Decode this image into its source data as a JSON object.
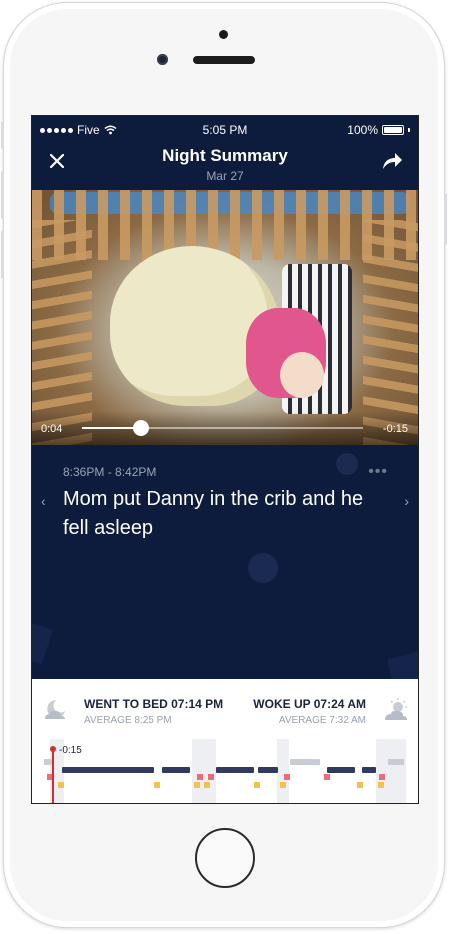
{
  "status_bar": {
    "carrier": "Five",
    "time": "5:05 PM",
    "battery": "100%",
    "battery_level": 1.0
  },
  "nav": {
    "title": "Night Summary",
    "subtitle": "Mar 27"
  },
  "video": {
    "elapsed": "0:04",
    "remaining": "-0:15",
    "progress": 0.21
  },
  "event": {
    "time_range": "8:36PM - 8:42PM",
    "more": "•••",
    "description": "Mom put Danny in the crib and he fell asleep",
    "prev": "‹",
    "next": "›"
  },
  "summary": {
    "bed_label": "WENT TO BED 07:14 PM",
    "bed_avg": "AVERAGE 8:25 PM",
    "wake_label": "WOKE UP 07:24 AM",
    "wake_avg": "AVERAGE 7:32 AM",
    "cursor_label": "-0:15"
  },
  "icons": {
    "close": "close-icon",
    "share": "share-icon",
    "moon": "moon-cloud-icon",
    "sun": "sun-cloud-icon",
    "wifi": "wifi-icon"
  },
  "colors": {
    "background": "#0d1b3d",
    "timeline_sleep": "#2f3a5e",
    "timeline_awake": "#c9ccd4",
    "event_pink": "#ef6a7a",
    "event_yellow": "#f2c14e",
    "cursor": "#d0312d"
  }
}
